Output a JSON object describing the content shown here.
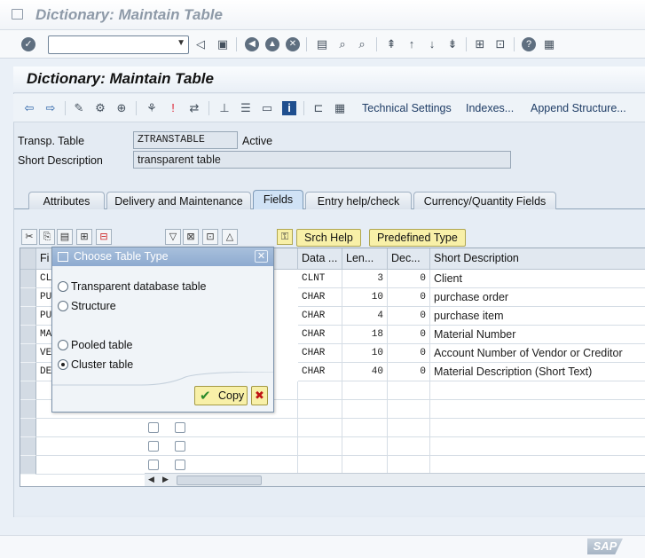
{
  "window": {
    "title": "Dictionary: Maintain Table"
  },
  "toolbar": {
    "command_value": ""
  },
  "app": {
    "title": "Dictionary: Maintain Table",
    "buttons": {
      "technical_settings": "Technical Settings",
      "indexes": "Indexes...",
      "append_structure": "Append Structure..."
    }
  },
  "header": {
    "transp_table_label": "Transp. Table",
    "transp_table_value": "ZTRANSTABLE",
    "status": "Active",
    "short_desc_label": "Short Description",
    "short_desc_value": "transparent table"
  },
  "tabs": [
    {
      "label": "Attributes"
    },
    {
      "label": "Delivery and Maintenance"
    },
    {
      "label": "Fields"
    },
    {
      "label": "Entry help/check"
    },
    {
      "label": "Currency/Quantity Fields"
    }
  ],
  "field_toolbar": {
    "srch_help": "Srch Help",
    "predefined_type": "Predefined Type"
  },
  "grid": {
    "columns": {
      "field": "Fi",
      "data_type": "Data ...",
      "length": "Len...",
      "decimals": "Dec...",
      "short_desc": "Short Description"
    },
    "rows": [
      {
        "field": "CL",
        "type": "CLNT",
        "len": "3",
        "dec": "0",
        "desc": "Client"
      },
      {
        "field": "PU",
        "type": "CHAR",
        "len": "10",
        "dec": "0",
        "desc": "purchase order"
      },
      {
        "field": "PU",
        "type": "CHAR",
        "len": "4",
        "dec": "0",
        "desc": "purchase item"
      },
      {
        "field": "MA",
        "type": "CHAR",
        "len": "18",
        "dec": "0",
        "desc": "Material Number"
      },
      {
        "field": "VE",
        "type": "CHAR",
        "len": "10",
        "dec": "0",
        "desc": "Account Number of Vendor or Creditor"
      },
      {
        "field": "DE",
        "type": "CHAR",
        "len": "40",
        "dec": "0",
        "desc": "Material Description (Short Text)"
      }
    ]
  },
  "dialog": {
    "title": "Choose Table Type",
    "options": {
      "transparent": "Transparent database table",
      "structure": "Structure",
      "pooled": "Pooled table",
      "cluster": "Cluster table"
    },
    "selected": "cluster",
    "copy_label": "Copy"
  },
  "branding": {
    "logo": "SAP"
  }
}
